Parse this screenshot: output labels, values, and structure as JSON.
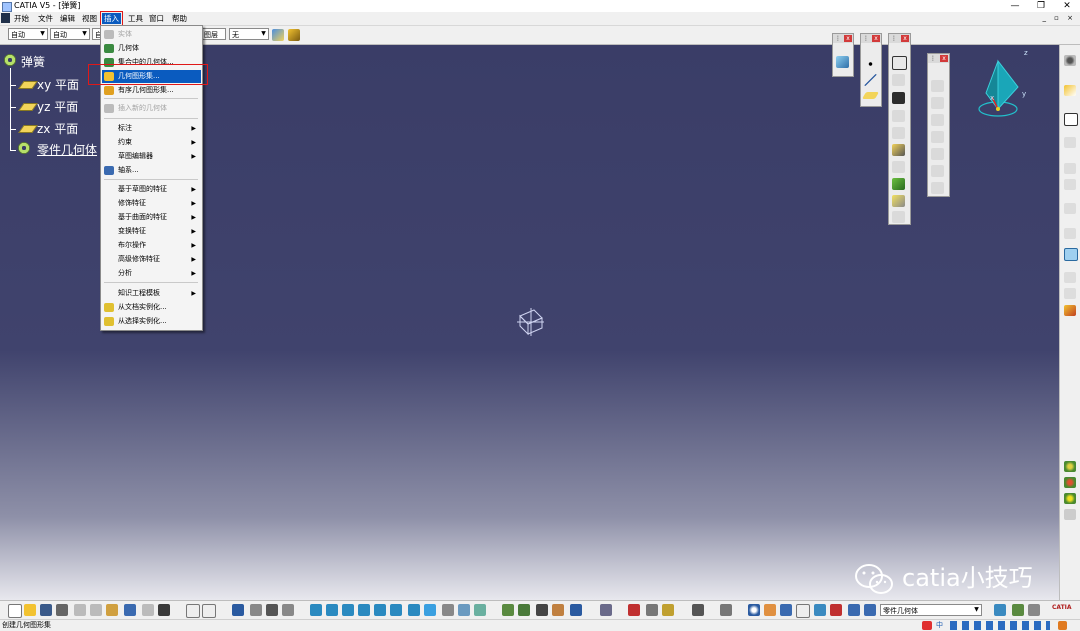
{
  "window": {
    "title": "CATIA V5 - [弹簧]",
    "controls": [
      "—",
      "❐",
      "✕"
    ]
  },
  "menubar": {
    "items": [
      "开始",
      "文件",
      "编辑",
      "视图",
      "插入",
      "工具",
      "窗口",
      "帮助"
    ],
    "active": "插入"
  },
  "toolbar_top": {
    "combo1": "自动",
    "combo2": "自动",
    "combo3_partial": "自",
    "combo4_partial": "图层",
    "combo5": "无"
  },
  "tree": {
    "root": "弹簧",
    "items": [
      "xy 平面",
      "yz 平面",
      "zx 平面",
      "零件几何体"
    ]
  },
  "insert_menu": {
    "items": [
      {
        "label": "实体",
        "disabled": true,
        "submenu": false
      },
      {
        "label": "几何体",
        "disabled": false,
        "submenu": false
      },
      {
        "label": "集合中的几何体...",
        "disabled": false,
        "submenu": false
      },
      {
        "label": "几何图形集...",
        "disabled": false,
        "submenu": false,
        "highlighted": true
      },
      {
        "label": "有序几何图形集...",
        "disabled": false,
        "submenu": false
      },
      {
        "label": "插入新的几何体",
        "disabled": true,
        "submenu": false
      },
      {
        "label": "标注",
        "disabled": false,
        "submenu": true
      },
      {
        "label": "约束",
        "disabled": false,
        "submenu": true
      },
      {
        "label": "草图编辑器",
        "disabled": false,
        "submenu": true
      },
      {
        "label": "轴系...",
        "disabled": false,
        "submenu": false
      },
      {
        "label": "基于草图的特征",
        "disabled": false,
        "submenu": true
      },
      {
        "label": "修饰特征",
        "disabled": false,
        "submenu": true
      },
      {
        "label": "基于曲面的特征",
        "disabled": false,
        "submenu": true
      },
      {
        "label": "变换特征",
        "disabled": false,
        "submenu": true
      },
      {
        "label": "布尔操作",
        "disabled": false,
        "submenu": true
      },
      {
        "label": "高级修饰特征",
        "disabled": false,
        "submenu": true
      },
      {
        "label": "分析",
        "disabled": false,
        "submenu": true
      },
      {
        "label": "知识工程模板",
        "disabled": false,
        "submenu": true
      },
      {
        "label": "从文档实例化...",
        "disabled": false,
        "submenu": false
      },
      {
        "label": "从选择实例化...",
        "disabled": false,
        "submenu": false
      }
    ]
  },
  "compass": {
    "x": "x",
    "y": "y",
    "z": "z"
  },
  "bottom_toolbar": {
    "body_combo": "零件几何体",
    "catia_logo": "CATIA"
  },
  "status": {
    "text": "创建几何图形集"
  },
  "watermark": {
    "text": "catia小技巧"
  },
  "ime": {
    "text": "中"
  },
  "colors": {
    "canvas_top": "#3a3d67",
    "highlight": "#0a5bbf",
    "callout": "#e01818"
  }
}
